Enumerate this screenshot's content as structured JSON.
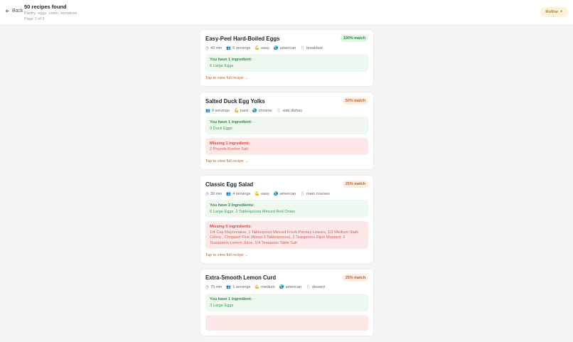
{
  "header": {
    "back_label": "Back",
    "title": "50 recipes found",
    "subtitle": "Pantry: eggs, onion, tomatoes",
    "page": "Page 1 of 3",
    "refine_label": "Refine"
  },
  "recipes": [
    {
      "title": "Easy-Peel Hard-Boiled Eggs",
      "match": "100% match",
      "time": "40 min",
      "servings": "6 servings",
      "difficulty": "easy",
      "cuisine": "american",
      "course": "breakfast",
      "have_label": "You have 1 ingredient:",
      "have": "6 Large Eggs",
      "missing_label": "",
      "missing": "",
      "tap": "Tap to view full recipe →"
    },
    {
      "title": "Salted Duck Egg Yolks",
      "match": "50% match",
      "time": "",
      "servings": "9 servings",
      "difficulty": "hard",
      "cuisine": "chinese",
      "course": "side dishes",
      "have_label": "You have 1 ingredient:",
      "have": "9 Duck Eggs",
      "missing_label": "Missing 1 ingredient:",
      "missing": "2 Pounds Kosher Salt",
      "tap": "Tap to view full recipe →"
    },
    {
      "title": "Classic Egg Salad",
      "match": "25% match",
      "time": "30 min",
      "servings": "4 servings",
      "difficulty": "easy",
      "cuisine": "american",
      "course": "main courses",
      "have_label": "You have 2 ingredients:",
      "have": "6 Large Eggs, 2 Tablespoons Minced Red Onion",
      "missing_label": "Missing 6 ingredients:",
      "missing": "1/4 Cup Mayonnaise, 1 Tablespoon Minced Fresh Parsley Leaves, 1/2 Medium Stalk Celery , Chopped Fine (About 3 Tablespoons), 2 Teaspoons Dijon Mustard, 2 Teaspoons Lemon Juice, 1/4 Teaspoon Table Salt",
      "tap": "Tap to view full recipe →"
    },
    {
      "title": "Extra-Smooth Lemon Curd",
      "match": "25% match",
      "time": "75 min",
      "servings": "1 servings",
      "difficulty": "medium",
      "cuisine": "american",
      "course": "dessert",
      "have_label": "You have 1 ingredient:",
      "have": "3 Large Eggs",
      "missing_label": "",
      "missing": "",
      "tap": ""
    }
  ],
  "colors": {
    "accent": "#c0642a",
    "have_green": "#2e8b3e",
    "missing_red": "#d04a4a",
    "refine_bg": "#fdf1d6"
  }
}
